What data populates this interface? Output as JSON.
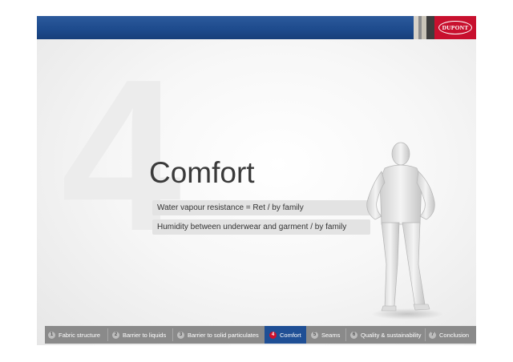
{
  "brand": {
    "logo_text": "DUPONT"
  },
  "slide": {
    "big_number": "4",
    "title": "Comfort",
    "bullets": [
      "Water vapour resistance = Ret / by family",
      "Humidity between underwear and garment / by family"
    ]
  },
  "nav": {
    "items": [
      {
        "num": "1",
        "label": "Fabric structure"
      },
      {
        "num": "2",
        "label": "Barrier to liquids"
      },
      {
        "num": "3",
        "label": "Barrier to solid particulates"
      },
      {
        "num": "4",
        "label": "Comfort"
      },
      {
        "num": "5",
        "label": "Seams"
      },
      {
        "num": "6",
        "label": "Quality & sustainability"
      },
      {
        "num": "7",
        "label": "Conclusion"
      }
    ],
    "active_index": 3
  },
  "colors": {
    "topbar_blue": "#1d4a8c",
    "brand_red": "#c8102e",
    "nav_gray": "#8a8a8a",
    "active_blue": "#1f4f95"
  }
}
